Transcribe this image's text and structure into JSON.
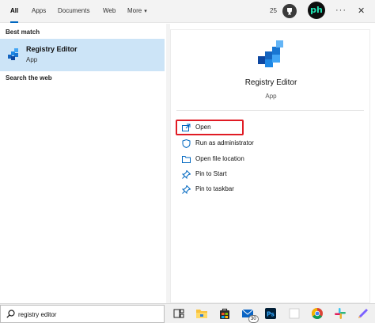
{
  "tabs": [
    {
      "label": "All",
      "active": true
    },
    {
      "label": "Apps",
      "active": false
    },
    {
      "label": "Documents",
      "active": false
    },
    {
      "label": "Web",
      "active": false
    },
    {
      "label": "More",
      "active": false
    }
  ],
  "header": {
    "points": "25",
    "avatar_text": "ph",
    "more_options_glyph": "···",
    "close_glyph": "✕"
  },
  "left": {
    "best_match_title": "Best match",
    "best_match": {
      "name": "Registry Editor",
      "type": "App",
      "icon": "registry-editor-icon"
    },
    "search_web_title": "Search the web"
  },
  "preview": {
    "name": "Registry Editor",
    "type": "App",
    "actions": [
      {
        "label": "Open",
        "icon": "open-icon"
      },
      {
        "label": "Run as administrator",
        "icon": "shield-icon"
      },
      {
        "label": "Open file location",
        "icon": "folder-icon"
      },
      {
        "label": "Pin to Start",
        "icon": "pin-icon"
      },
      {
        "label": "Pin to taskbar",
        "icon": "pin-icon"
      }
    ]
  },
  "taskbar": {
    "search_value": "registry editor",
    "mail_badge": "30",
    "apps": [
      "task-view-icon",
      "file-explorer-icon",
      "microsoft-store-icon",
      "mail-icon",
      "photoshop-icon",
      "blank-app-icon",
      "chrome-icon",
      "slack-icon",
      "drawing-app-icon"
    ]
  },
  "colors": {
    "accent": "#0067c0",
    "selection": "#cce4f7",
    "highlight_box": "#e01b24"
  }
}
